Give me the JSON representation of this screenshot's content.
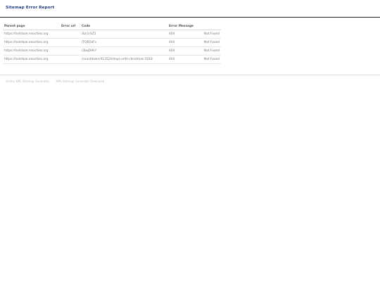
{
  "header": {
    "title": "Sitemap Error Report"
  },
  "table": {
    "columns": [
      "Parent page",
      "Error url",
      "Code",
      "Error Message",
      ""
    ],
    "rows": [
      {
        "parent": "https://holidaze.neocities.org",
        "url": "",
        "code": "/Ezi1rSZ1",
        "message": "404",
        "status": "Not Found"
      },
      {
        "parent": "https://holidaze.neocities.org",
        "url": "",
        "code": "/TQ6DaFv",
        "message": "404",
        "status": "Not Found"
      },
      {
        "parent": "https://holidaze.neocities.org",
        "url": "",
        "code": "/2bqDHkY",
        "message": "404",
        "status": "Not Found"
      },
      {
        "parent": "https://holidaze.neocities.org",
        "url": "",
        "code": "/countdown/413524/days-until-christmas-2018",
        "message": "404",
        "status": "Not Found"
      }
    ]
  },
  "footer": {
    "links": [
      "Online XML Sitemap Generator",
      "XML Sitemap Generator Download"
    ]
  }
}
